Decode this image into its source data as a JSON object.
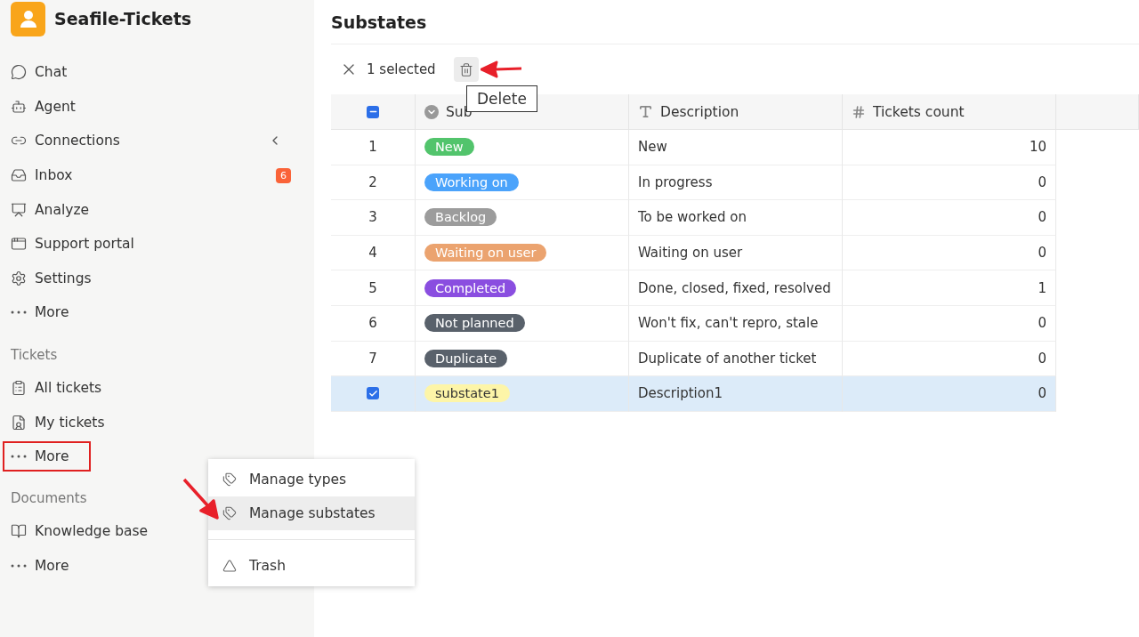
{
  "app": {
    "name": "Seafile-Tickets"
  },
  "sidebar": {
    "items": [
      {
        "label": "Chat"
      },
      {
        "label": "Agent"
      },
      {
        "label": "Connections",
        "collapse_caret": true
      },
      {
        "label": "Inbox",
        "badge": "6"
      },
      {
        "label": "Analyze"
      },
      {
        "label": "Support portal"
      },
      {
        "label": "Settings"
      },
      {
        "label": "More"
      }
    ],
    "sections": [
      {
        "title": "Tickets",
        "items": [
          {
            "label": "All tickets",
            "highlighted": false
          },
          {
            "label": "My tickets",
            "highlighted": false
          },
          {
            "label": "More",
            "highlighted": true
          }
        ]
      },
      {
        "title": "Documents",
        "items": [
          {
            "label": "Knowledge base",
            "highlighted": false
          },
          {
            "label": "More",
            "highlighted": false
          }
        ]
      }
    ]
  },
  "page": {
    "title": "Substates"
  },
  "selection_bar": {
    "count_text": "1 selected",
    "tooltip": "Delete"
  },
  "table": {
    "header_checkbox_partial": true,
    "columns": [
      {
        "label": "Sub"
      },
      {
        "label": "Description"
      },
      {
        "label": "Tickets count"
      }
    ],
    "rows": [
      {
        "number": "1",
        "substate": "New",
        "color": "#52c46c",
        "dark_text": false,
        "description": "New",
        "count": "10",
        "selected": false
      },
      {
        "number": "2",
        "substate": "Working on",
        "color": "#4ba3fb",
        "dark_text": false,
        "description": "In progress",
        "count": "0",
        "selected": false
      },
      {
        "number": "3",
        "substate": "Backlog",
        "color": "#9c9c9c",
        "dark_text": false,
        "description": "To be worked on",
        "count": "0",
        "selected": false
      },
      {
        "number": "4",
        "substate": "Waiting on user",
        "color": "#eba36f",
        "dark_text": false,
        "description": "Waiting on user",
        "count": "0",
        "selected": false
      },
      {
        "number": "5",
        "substate": "Completed",
        "color": "#8a4ee0",
        "dark_text": false,
        "description": "Done, closed, fixed, resolved",
        "count": "1",
        "selected": false
      },
      {
        "number": "6",
        "substate": "Not planned",
        "color": "#59616b",
        "dark_text": false,
        "description": "Won't fix, can't repro, stale",
        "count": "0",
        "selected": false
      },
      {
        "number": "7",
        "substate": "Duplicate",
        "color": "#59616b",
        "dark_text": false,
        "description": "Duplicate of another ticket",
        "count": "0",
        "selected": false
      },
      {
        "substate": "substate1",
        "color": "#fdf5a8",
        "dark_text": true,
        "description": "Description1",
        "count": "0",
        "selected": true
      }
    ]
  },
  "context_menu": {
    "items": [
      {
        "label": "Manage types",
        "hovered": false
      },
      {
        "label": "Manage substates",
        "hovered": true
      },
      {
        "label": "Trash",
        "hovered": false
      }
    ]
  }
}
